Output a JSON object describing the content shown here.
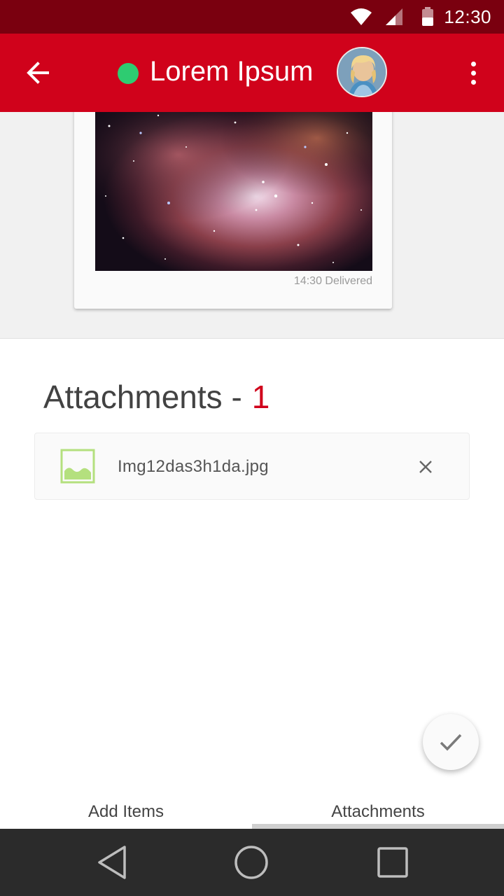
{
  "status_bar": {
    "time": "12:30",
    "icons": [
      "wifi-icon",
      "signal-icon",
      "battery-icon"
    ]
  },
  "header": {
    "back_icon": "arrow-left-icon",
    "contact_name": "Lorem Ipsum",
    "online_status_color": "#2ecc71",
    "more_icon": "more-vertical-icon"
  },
  "message": {
    "meta": "14:30 Delivered"
  },
  "attachments": {
    "title": "Attachments -",
    "count": "1",
    "items": [
      {
        "file_name": "Img12das3h1da.jpg",
        "icon": "image-file-icon",
        "remove_icon": "close-icon"
      }
    ]
  },
  "fab": {
    "icon": "check-icon"
  },
  "tabs": [
    {
      "label": "Add Items",
      "active": false
    },
    {
      "label": "Attachments",
      "active": true
    }
  ],
  "colors": {
    "primary": "#d0021b",
    "status_bar": "#7a000f",
    "accent_count": "#d0021b",
    "file_icon": "#b4e07e"
  }
}
